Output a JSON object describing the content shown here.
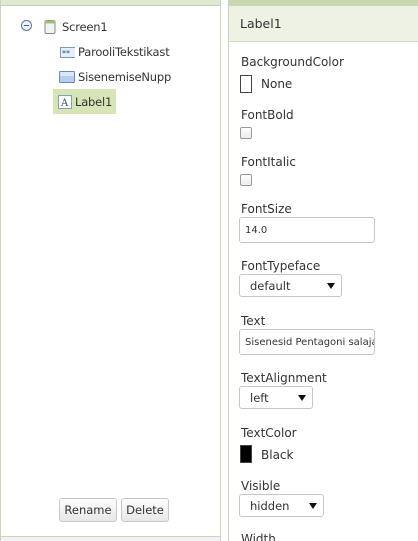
{
  "components": {
    "root": {
      "label": "Screen1",
      "icon": "screen-icon"
    },
    "children": [
      {
        "label": "ParooliTekstikast",
        "icon": "password-textbox-icon"
      },
      {
        "label": "SisenemiseNupp",
        "icon": "button-component-icon"
      },
      {
        "label": "Label1",
        "icon": "label-component-icon",
        "selected": true
      }
    ],
    "buttons": {
      "rename": "Rename",
      "delete": "Delete"
    }
  },
  "properties": {
    "component_name": "Label1",
    "background_color": {
      "label": "BackgroundColor",
      "value": "None",
      "swatch": "#ffffff"
    },
    "font_bold": {
      "label": "FontBold",
      "checked": false
    },
    "font_italic": {
      "label": "FontItalic",
      "checked": false
    },
    "font_size": {
      "label": "FontSize",
      "value": "14.0"
    },
    "font_typeface": {
      "label": "FontTypeface",
      "value": "default"
    },
    "text": {
      "label": "Text",
      "value": "Sisenesid Pentagoni salaja"
    },
    "text_alignment": {
      "label": "TextAlignment",
      "value": "left"
    },
    "text_color": {
      "label": "TextColor",
      "value": "Black",
      "swatch": "#000000"
    },
    "visible": {
      "label": "Visible",
      "value": "hidden"
    },
    "next_label": "Width"
  },
  "colors": {
    "selection": "#d5e5b5",
    "panel_header": "#edf2e4"
  }
}
